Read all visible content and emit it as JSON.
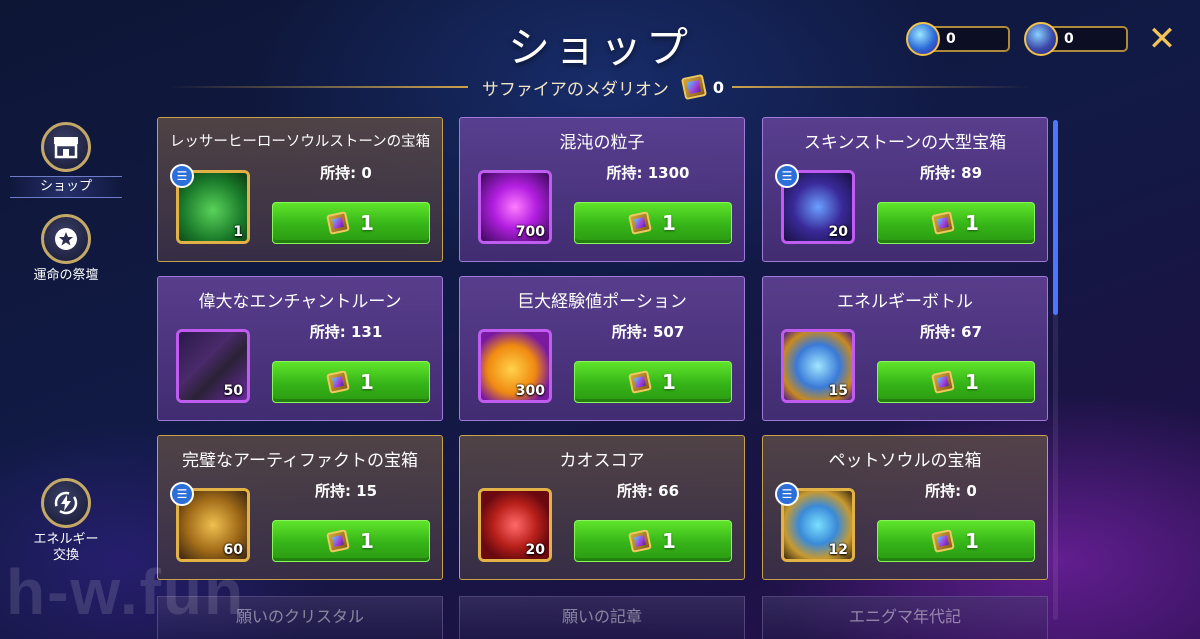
{
  "header": {
    "title": "ショップ"
  },
  "subtitle": {
    "text": "サファイアのメダリオン",
    "count": "0"
  },
  "currencies": [
    {
      "icon": "gem-icon",
      "value": "0"
    },
    {
      "icon": "star-emblem-icon",
      "value": "0"
    }
  ],
  "nav": [
    {
      "label": "ショップ",
      "icon": "shop-icon",
      "active": true
    },
    {
      "label": "運命の祭壇",
      "icon": "star-badge-icon",
      "active": false
    },
    {
      "label_1": "エネルギー",
      "label_2": "交換",
      "icon": "energy-exchange-icon",
      "active": false
    }
  ],
  "owned_label": "所持:",
  "items": [
    {
      "title": "レッサーヒーローソウルストーンの宝箱",
      "owned": "0",
      "qty": "1",
      "price": "1",
      "art": "green-chest-icon"
    },
    {
      "title": "混沌の粒子",
      "owned": "1300",
      "qty": "700",
      "price": "1",
      "art": "chaos-particle-icon"
    },
    {
      "title": "スキンストーンの大型宝箱",
      "owned": "89",
      "qty": "20",
      "price": "1",
      "art": "skin-stone-chest-icon"
    },
    {
      "title": "偉大なエンチャントルーン",
      "owned": "131",
      "qty": "50",
      "price": "1",
      "art": "enchant-rune-icon"
    },
    {
      "title": "巨大経験値ポーション",
      "owned": "507",
      "qty": "300",
      "price": "1",
      "art": "xp-potion-icon"
    },
    {
      "title": "エネルギーボトル",
      "owned": "67",
      "qty": "15",
      "price": "1",
      "art": "energy-bottle-icon"
    },
    {
      "title": "完璧なアーティファクトの宝箱",
      "owned": "15",
      "qty": "60",
      "price": "1",
      "art": "artifact-chest-icon"
    },
    {
      "title": "カオスコア",
      "owned": "66",
      "qty": "20",
      "price": "1",
      "art": "chaos-core-icon"
    },
    {
      "title": "ペットソウルの宝箱",
      "owned": "0",
      "qty": "12",
      "price": "1",
      "art": "pet-soul-chest-icon"
    }
  ],
  "partial_items": [
    {
      "title": "願いのクリスタル"
    },
    {
      "title": "願いの記章"
    },
    {
      "title": "エニグマ年代記"
    }
  ],
  "watermark": "h-w.fun"
}
